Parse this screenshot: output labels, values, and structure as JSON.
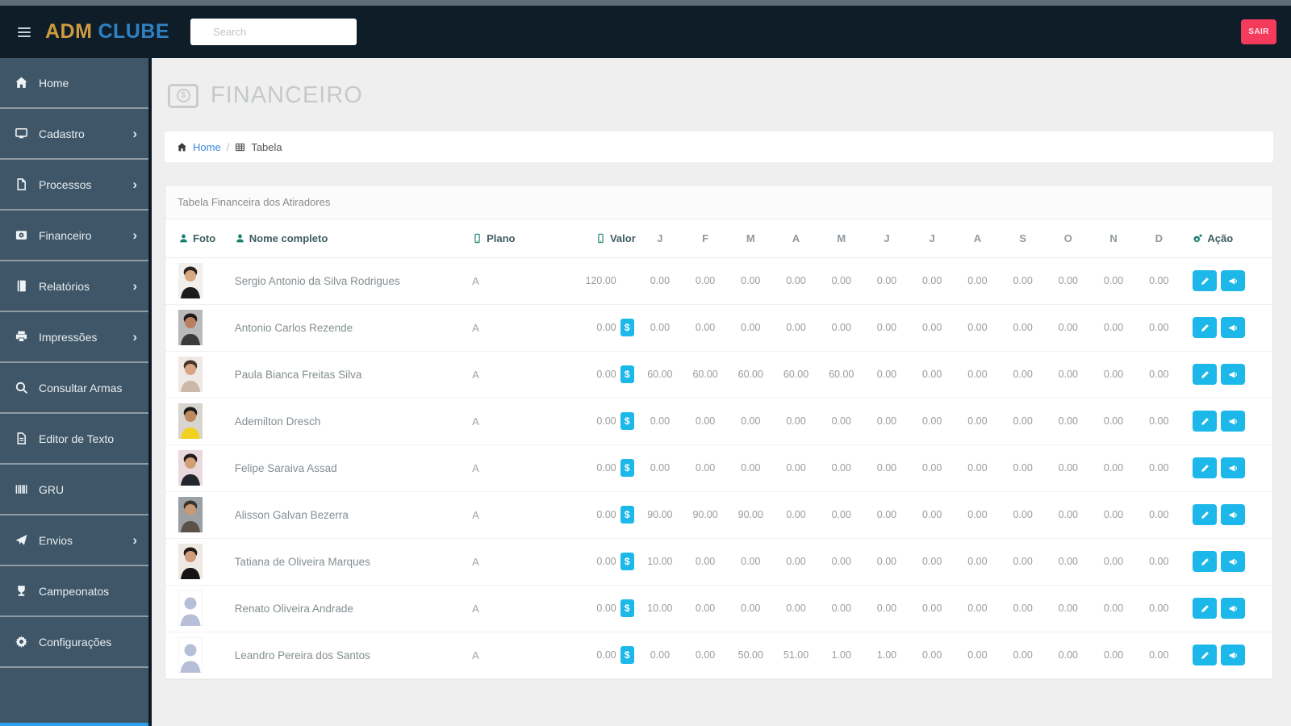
{
  "topbar": {
    "brand_adm": "ADM",
    "brand_clube": "CLUBE",
    "search_placeholder": "Search",
    "logout_label": "SAIR"
  },
  "sidebar": {
    "items": [
      {
        "label": "Home",
        "icon": "home",
        "has_submenu": false
      },
      {
        "label": "Cadastro",
        "icon": "monitor",
        "has_submenu": true
      },
      {
        "label": "Processos",
        "icon": "file",
        "has_submenu": true
      },
      {
        "label": "Financeiro",
        "icon": "dollar",
        "has_submenu": true
      },
      {
        "label": "Relatórios",
        "icon": "book",
        "has_submenu": true
      },
      {
        "label": "Impressões",
        "icon": "printer",
        "has_submenu": true
      },
      {
        "label": "Consultar Armas",
        "icon": "search",
        "has_submenu": false
      },
      {
        "label": "Editor de Texto",
        "icon": "file-text",
        "has_submenu": false
      },
      {
        "label": "GRU",
        "icon": "barcode",
        "has_submenu": false
      },
      {
        "label": "Envios",
        "icon": "paper-plane",
        "has_submenu": true
      },
      {
        "label": "Campeonatos",
        "icon": "trophy",
        "has_submenu": false
      },
      {
        "label": "Configurações",
        "icon": "gear",
        "has_submenu": false
      }
    ]
  },
  "page": {
    "title": "FINANCEIRO",
    "title_icon": "dollar-square",
    "breadcrumb": {
      "home": "Home",
      "current": "Tabela"
    }
  },
  "panel": {
    "title": "Tabela Financeira dos Atiradores"
  },
  "table": {
    "headers": {
      "foto": "Foto",
      "nome": "Nome completo",
      "plano": "Plano",
      "valor": "Valor",
      "acao": "Ação",
      "months": [
        "J",
        "F",
        "M",
        "A",
        "M",
        "J",
        "J",
        "A",
        "S",
        "O",
        "N",
        "D"
      ]
    },
    "rows": [
      {
        "name": "Sergio Antonio da Silva Rodrigues",
        "plan": "A",
        "value": "120.00",
        "has_money_badge": false,
        "months": [
          "0.00",
          "0.00",
          "0.00",
          "0.00",
          "0.00",
          "0.00",
          "0.00",
          "0.00",
          "0.00",
          "0.00",
          "0.00",
          "0.00"
        ],
        "photo": {
          "placeholder": false,
          "bg": "#f2f0ec",
          "hair": "#2a2320",
          "skin": "#d9a97f",
          "shirt": "#1c1c1c"
        }
      },
      {
        "name": "Antonio Carlos Rezende",
        "plan": "A",
        "value": "0.00",
        "has_money_badge": true,
        "months": [
          "0.00",
          "0.00",
          "0.00",
          "0.00",
          "0.00",
          "0.00",
          "0.00",
          "0.00",
          "0.00",
          "0.00",
          "0.00",
          "0.00"
        ],
        "photo": {
          "placeholder": false,
          "bg": "#b9b9b9",
          "hair": "#1f1a17",
          "skin": "#b97f5e",
          "shirt": "#3a3a3a"
        }
      },
      {
        "name": "Paula Bianca Freitas Silva",
        "plan": "A",
        "value": "0.00",
        "has_money_badge": true,
        "months": [
          "60.00",
          "60.00",
          "60.00",
          "60.00",
          "60.00",
          "0.00",
          "0.00",
          "0.00",
          "0.00",
          "0.00",
          "0.00",
          "0.00"
        ],
        "photo": {
          "placeholder": false,
          "bg": "#efe9e6",
          "hair": "#4a352c",
          "skin": "#d8a685",
          "shirt": "#cbb8a8"
        }
      },
      {
        "name": "Ademilton Dresch",
        "plan": "A",
        "value": "0.00",
        "has_money_badge": true,
        "months": [
          "0.00",
          "0.00",
          "0.00",
          "0.00",
          "0.00",
          "0.00",
          "0.00",
          "0.00",
          "0.00",
          "0.00",
          "0.00",
          "0.00"
        ],
        "photo": {
          "placeholder": false,
          "bg": "#d8d4cf",
          "hair": "#1d1b18",
          "skin": "#c08a5f",
          "shirt": "#f2d022"
        }
      },
      {
        "name": "Felipe Saraiva Assad",
        "plan": "A",
        "value": "0.00",
        "has_money_badge": true,
        "months": [
          "0.00",
          "0.00",
          "0.00",
          "0.00",
          "0.00",
          "0.00",
          "0.00",
          "0.00",
          "0.00",
          "0.00",
          "0.00",
          "0.00"
        ],
        "photo": {
          "placeholder": false,
          "bg": "#e8d9dc",
          "hair": "#241d1a",
          "skin": "#d3a075",
          "shirt": "#24262e"
        }
      },
      {
        "name": "Alisson Galvan Bezerra",
        "plan": "A",
        "value": "0.00",
        "has_money_badge": true,
        "months": [
          "90.00",
          "90.00",
          "90.00",
          "0.00",
          "0.00",
          "0.00",
          "0.00",
          "0.00",
          "0.00",
          "0.00",
          "0.00",
          "0.00"
        ],
        "photo": {
          "placeholder": false,
          "bg": "#9aa0a4",
          "hair": "#3c332c",
          "skin": "#c69a76",
          "shirt": "#5a5148"
        }
      },
      {
        "name": "Tatiana de Oliveira Marques",
        "plan": "A",
        "value": "0.00",
        "has_money_badge": true,
        "months": [
          "10.00",
          "0.00",
          "0.00",
          "0.00",
          "0.00",
          "0.00",
          "0.00",
          "0.00",
          "0.00",
          "0.00",
          "0.00",
          "0.00"
        ],
        "photo": {
          "placeholder": false,
          "bg": "#efe9e4",
          "hair": "#201a18",
          "skin": "#cf9d7c",
          "shirt": "#141414"
        }
      },
      {
        "name": "Renato Oliveira Andrade",
        "plan": "A",
        "value": "0.00",
        "has_money_badge": true,
        "months": [
          "10.00",
          "0.00",
          "0.00",
          "0.00",
          "0.00",
          "0.00",
          "0.00",
          "0.00",
          "0.00",
          "0.00",
          "0.00",
          "0.00"
        ],
        "photo": {
          "placeholder": true,
          "bg": "#ffffff",
          "silhouette": "#b7bed8"
        }
      },
      {
        "name": "Leandro Pereira dos Santos",
        "plan": "A",
        "value": "0.00",
        "has_money_badge": true,
        "months": [
          "0.00",
          "0.00",
          "50.00",
          "51.00",
          "1.00",
          "1.00",
          "0.00",
          "0.00",
          "0.00",
          "0.00",
          "0.00",
          "0.00"
        ],
        "photo": {
          "placeholder": true,
          "bg": "#ffffff",
          "silhouette": "#b7bed8"
        }
      }
    ]
  },
  "action_icons": [
    "edit",
    "announce"
  ],
  "colors": {
    "topbar": "#0f1d29",
    "sidebar": "#3f5668",
    "sidebar_divider": "#8e9ba4",
    "brand_orange": "#cf9b3f",
    "brand_blue": "#2f81c2",
    "accent_aqua": "#1db8ea",
    "danger_red": "#f43b5c",
    "header_teal": "#17806d",
    "link_blue": "#3b86d8"
  }
}
